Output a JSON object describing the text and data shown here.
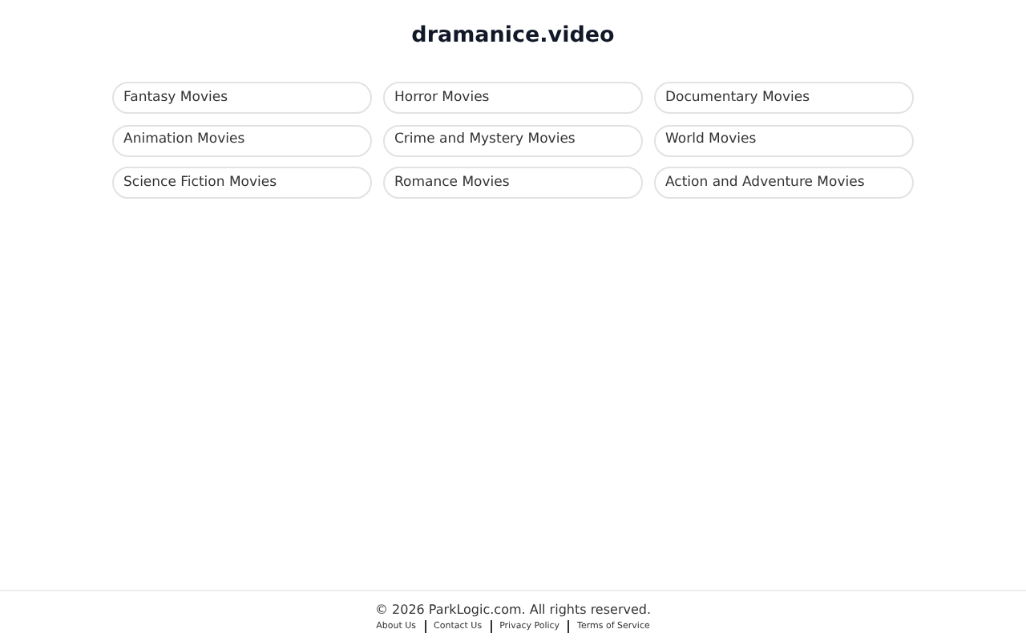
{
  "header": {
    "title": "dramanice.video"
  },
  "categories": [
    {
      "label": "Fantasy Movies"
    },
    {
      "label": "Horror Movies"
    },
    {
      "label": "Documentary Movies"
    },
    {
      "label": "Animation Movies"
    },
    {
      "label": "Crime and Mystery Movies"
    },
    {
      "label": "World Movies"
    },
    {
      "label": "Science Fiction Movies"
    },
    {
      "label": "Romance Movies"
    },
    {
      "label": "Action and Adventure Movies"
    }
  ],
  "footer": {
    "copyright": "© 2026 ParkLogic.com. All rights reserved.",
    "links": [
      "About Us",
      "Contact Us",
      "Privacy Policy",
      "Terms of Service"
    ]
  }
}
